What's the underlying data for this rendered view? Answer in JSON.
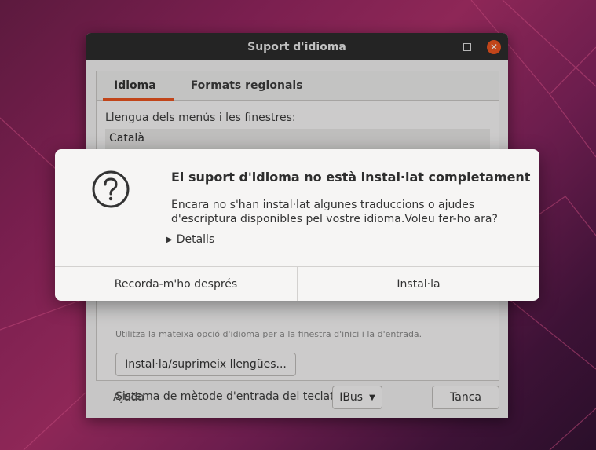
{
  "window": {
    "title": "Suport d'idioma",
    "tabs": [
      {
        "label": "Idioma",
        "active": true
      },
      {
        "label": "Formats regionals",
        "active": false
      }
    ],
    "language_label": "Llengua dels menús i les finestres:",
    "selected_language": "Català",
    "faded_hint": "Utilitza la mateixa opció d'idioma per a la finestra d'inici i la d'entrada.",
    "install_remove_button": "Instal·la/suprimeix llengües...",
    "input_method_label": "Sistema de mètode d'entrada del teclat:",
    "input_method_value": "IBus",
    "help_label": "Ajuda",
    "close_label": "Tanca"
  },
  "dialog": {
    "title": "El suport d'idioma no està instal·lat completament",
    "message_line1": "Encara no s'han instal·lat algunes traduccions o ajudes",
    "message_line2": "d'escriptura disponibles pel vostre idioma.Voleu fer-ho ara?",
    "details_label": "Detalls",
    "remind_later_button": "Recorda-m'ho després",
    "install_button": "Instal·la"
  },
  "colors": {
    "accent": "#e95420",
    "titlebar": "#2c2c2c"
  },
  "icons": {
    "dialog_icon": "question-icon",
    "window_minimize": "minimize-icon",
    "window_maximize": "maximize-icon",
    "window_close": "close-icon"
  }
}
